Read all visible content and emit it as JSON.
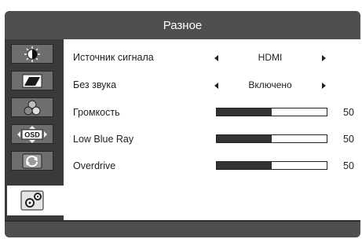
{
  "header": {
    "title": "Разное"
  },
  "sidebar": {
    "items": [
      {
        "icon": "brightness-icon",
        "active": false
      },
      {
        "icon": "image-settings-icon",
        "active": false
      },
      {
        "icon": "color-icon",
        "active": false
      },
      {
        "icon": "osd-settings-icon",
        "active": false,
        "label": "OSD"
      },
      {
        "icon": "reset-icon",
        "active": false
      },
      {
        "icon": "gears-icon",
        "active": true
      }
    ]
  },
  "settings": {
    "source": {
      "label": "Источник сигнала",
      "value": "HDMI"
    },
    "mute": {
      "label": "Без звука",
      "value": "Включено"
    },
    "volume": {
      "label": "Громкость",
      "value": "50",
      "level": 0.5
    },
    "low_blue_ray": {
      "label": "Low Blue Ray",
      "value": "50",
      "level": 0.5
    },
    "overdrive": {
      "label": "Overdrive",
      "value": "50",
      "level": 0.5
    }
  },
  "colors": {
    "frame": "#4f4f4f",
    "sidebar": "#3a3a3a",
    "content": "#ffffff",
    "fill": "#333333"
  }
}
